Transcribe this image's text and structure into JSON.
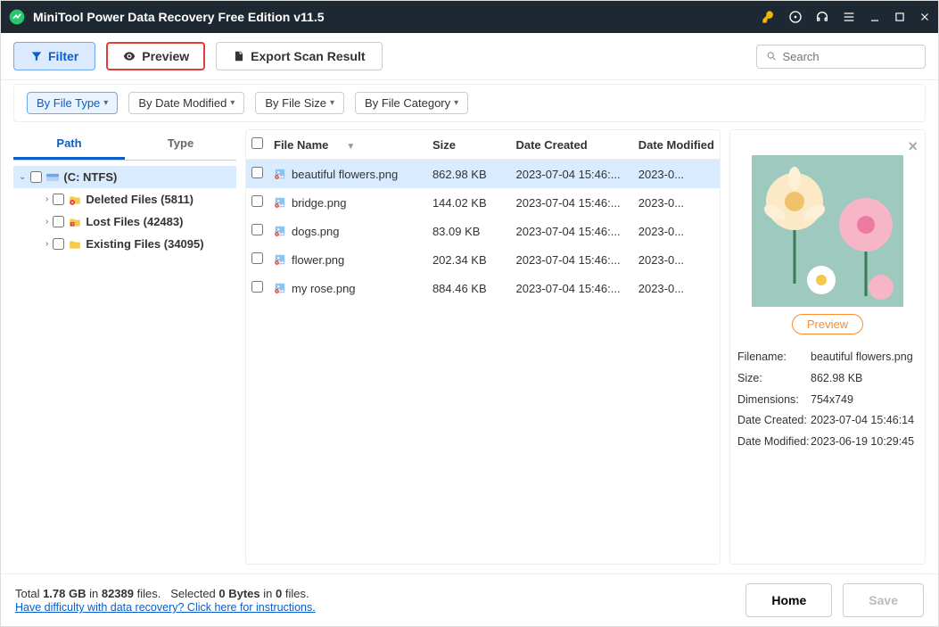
{
  "title": "MiniTool Power Data Recovery Free Edition v11.5",
  "toolbar": {
    "filter_label": "Filter",
    "preview_label": "Preview",
    "export_label": "Export Scan Result",
    "search_placeholder": "Search"
  },
  "filterbar": {
    "file_type": "By File Type",
    "date_modified": "By Date Modified",
    "file_size": "By File Size",
    "file_category": "By File Category"
  },
  "tabs": {
    "path": "Path",
    "type": "Type"
  },
  "tree": {
    "root": "(C: NTFS)",
    "deleted": "Deleted Files (5811)",
    "lost": "Lost Files (42483)",
    "existing": "Existing Files (34095)"
  },
  "columns": {
    "name": "File Name",
    "size": "Size",
    "date_created": "Date Created",
    "date_modified": "Date Modified"
  },
  "files": [
    {
      "name": "beautiful flowers.png",
      "size": "862.98 KB",
      "date_created": "2023-07-04 15:46:...",
      "date_modified": "2023-0..."
    },
    {
      "name": "bridge.png",
      "size": "144.02 KB",
      "date_created": "2023-07-04 15:46:...",
      "date_modified": "2023-0..."
    },
    {
      "name": "dogs.png",
      "size": "83.09 KB",
      "date_created": "2023-07-04 15:46:...",
      "date_modified": "2023-0..."
    },
    {
      "name": "flower.png",
      "size": "202.34 KB",
      "date_created": "2023-07-04 15:46:...",
      "date_modified": "2023-0..."
    },
    {
      "name": "my rose.png",
      "size": "884.46 KB",
      "date_created": "2023-07-04 15:46:...",
      "date_modified": "2023-0..."
    }
  ],
  "preview": {
    "button": "Preview",
    "filename_label": "Filename:",
    "filename": "beautiful flowers.png",
    "size_label": "Size:",
    "size": "862.98 KB",
    "dimensions_label": "Dimensions:",
    "dimensions": "754x749",
    "date_created_label": "Date Created:",
    "date_created": "2023-07-04 15:46:14",
    "date_modified_label": "Date Modified:",
    "date_modified": "2023-06-19 10:29:45"
  },
  "footer": {
    "total_prefix": "Total ",
    "total_size": "1.78 GB",
    "total_mid": " in ",
    "total_count": "82389",
    "total_suffix": " files.",
    "selected_prefix": "Selected ",
    "selected_bytes": "0 Bytes",
    "selected_mid": " in ",
    "selected_count": "0",
    "selected_suffix": " files.",
    "help_link": "Have difficulty with data recovery? Click here for instructions.",
    "home": "Home",
    "save": "Save"
  }
}
